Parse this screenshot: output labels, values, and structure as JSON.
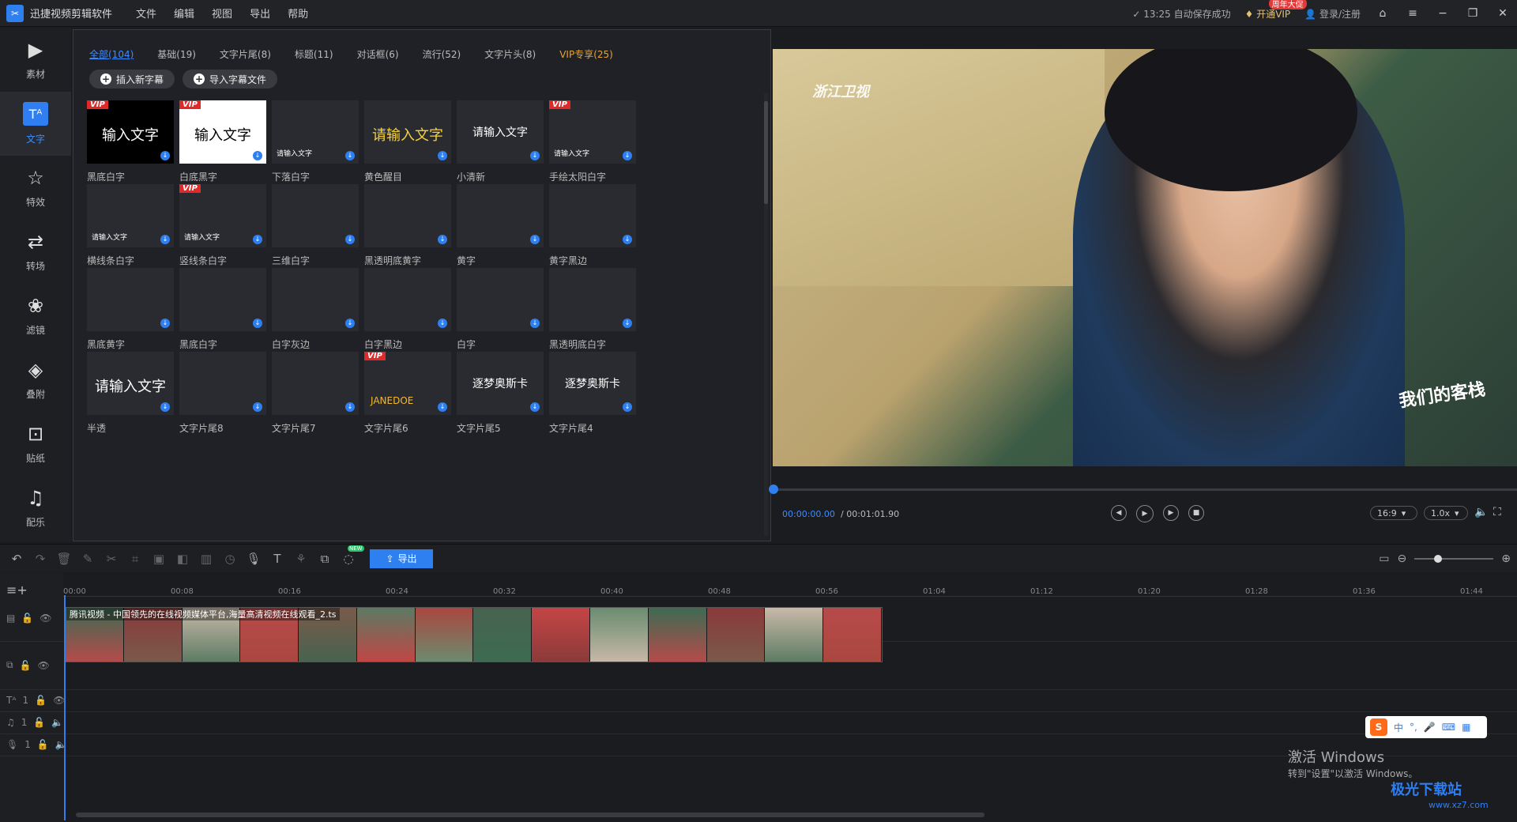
{
  "titlebar": {
    "app_title": "迅捷视频剪辑软件",
    "menus": [
      "文件",
      "编辑",
      "视图",
      "导出",
      "帮助"
    ],
    "autosave": "13:25 自动保存成功",
    "vip_label": "开通VIP",
    "vip_badge": "周年大促",
    "login": "登录/注册"
  },
  "sidebar": {
    "items": [
      {
        "label": "素材",
        "icon": "media-icon"
      },
      {
        "label": "文字",
        "icon": "text-icon"
      },
      {
        "label": "特效",
        "icon": "effects-icon"
      },
      {
        "label": "转场",
        "icon": "transition-icon"
      },
      {
        "label": "滤镜",
        "icon": "filter-icon"
      },
      {
        "label": "叠附",
        "icon": "overlay-icon"
      },
      {
        "label": "贴纸",
        "icon": "sticker-icon"
      },
      {
        "label": "配乐",
        "icon": "music-icon"
      }
    ],
    "active_index": 1
  },
  "panel": {
    "tabs": [
      "全部(104)",
      "基础(19)",
      "文字片尾(8)",
      "标题(11)",
      "对话框(6)",
      "流行(52)",
      "文字片头(8)",
      "VIP专享(25)"
    ],
    "insert_button": "插入新字幕",
    "import_button": "导入字幕文件",
    "cells": [
      {
        "label": "黑底白字",
        "text": "输入文字",
        "style": "black",
        "vip": true
      },
      {
        "label": "白底黑字",
        "text": "输入文字",
        "style": "white",
        "vip": true
      },
      {
        "label": "下落白字",
        "text": "请输入文字",
        "style": "small",
        "vip": false
      },
      {
        "label": "黄色醒目",
        "text": "请输入文字",
        "style": "yellow",
        "vip": false
      },
      {
        "label": "小清新",
        "text": "请输入文字",
        "style": "mid",
        "vip": false
      },
      {
        "label": "手绘太阳白字",
        "text": "请输入文字",
        "style": "small",
        "vip": true
      },
      {
        "label": "横线条白字",
        "text": "请输入文字",
        "style": "small",
        "vip": false
      },
      {
        "label": "竖线条白字",
        "text": "请输入文字",
        "style": "small",
        "vip": true
      },
      {
        "label": "三维白字",
        "text": "",
        "style": "small",
        "vip": false
      },
      {
        "label": "黑透明底黄字",
        "text": "",
        "style": "small",
        "vip": false
      },
      {
        "label": "黄字",
        "text": "",
        "style": "small",
        "vip": false
      },
      {
        "label": "黄字黑边",
        "text": "",
        "style": "small",
        "vip": false
      },
      {
        "label": "黑底黄字",
        "text": "",
        "style": "small",
        "vip": false
      },
      {
        "label": "黑底白字",
        "text": "",
        "style": "small",
        "vip": false
      },
      {
        "label": "白字灰边",
        "text": "",
        "style": "small",
        "vip": false
      },
      {
        "label": "白字黑边",
        "text": "",
        "style": "small",
        "vip": false
      },
      {
        "label": "白字",
        "text": "",
        "style": "small",
        "vip": false
      },
      {
        "label": "黑透明底白字",
        "text": "",
        "style": "small",
        "vip": false
      },
      {
        "label": "半透",
        "text": "请输入文字",
        "style": "big",
        "vip": false
      },
      {
        "label": "文字片尾8",
        "text": "",
        "style": "credits",
        "vip": false
      },
      {
        "label": "文字片尾7",
        "text": "",
        "style": "credits",
        "vip": false
      },
      {
        "label": "文字片尾6",
        "text": "JANEDOE",
        "style": "director",
        "vip": true
      },
      {
        "label": "文字片尾5",
        "text": "逐梦奥斯卡",
        "style": "mid",
        "vip": false
      },
      {
        "label": "文字片尾4",
        "text": "逐梦奥斯卡",
        "style": "mid",
        "vip": false
      }
    ]
  },
  "preview": {
    "channel_logo": "浙江卫视",
    "show_logo": "我们的客栈",
    "time_current": "00:00:00.00",
    "time_total": "/ 00:01:01.90",
    "ratio": "16:9",
    "speed": "1.0x",
    "progress": 0
  },
  "toolbar": {
    "export_label": "导出",
    "new_badge": "NEW"
  },
  "timeline": {
    "ticks": [
      "00:00",
      "00:08",
      "00:16",
      "00:24",
      "00:32",
      "00:40",
      "00:48",
      "00:56",
      "01:04",
      "01:12",
      "01:20",
      "01:28",
      "01:36",
      "01:44"
    ],
    "clip_name": "腾讯视频 - 中国领先的在线视频媒体平台,海量高清视频在线观看_2.ts",
    "track_number": "1"
  },
  "overlay": {
    "win_activate": "激活 Windows",
    "win_activate_sub": "转到\"设置\"以激活 Windows。",
    "ime_text": "中",
    "site_watermark": "极光下载站",
    "site_url": "www.xz7.com"
  }
}
